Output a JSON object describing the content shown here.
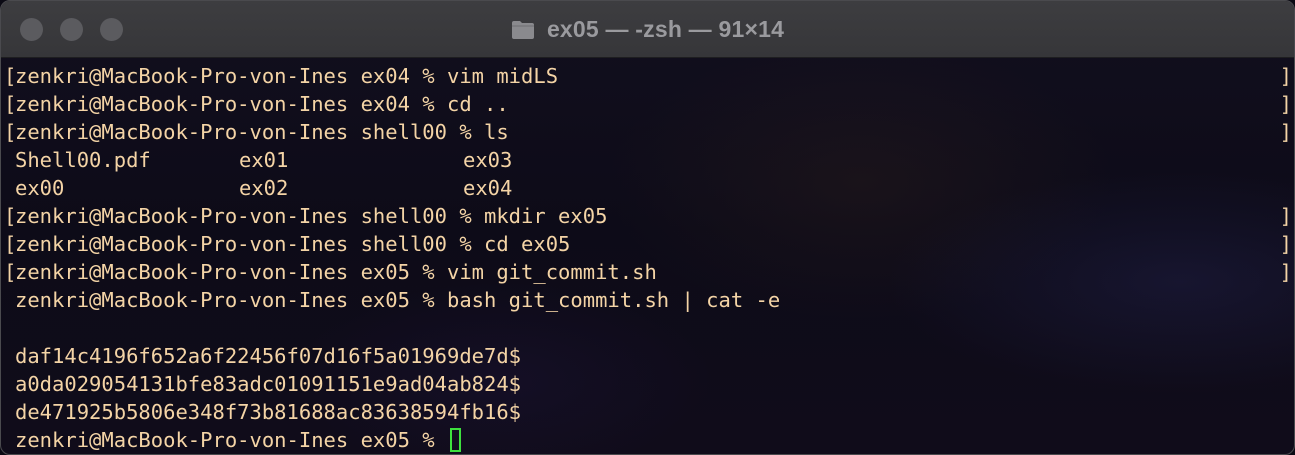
{
  "window": {
    "title": "ex05 — -zsh — 91×14"
  },
  "terminal": {
    "lines": [
      "zenkri@MacBook-Pro-von-Ines ex04 % vim midLS",
      "zenkri@MacBook-Pro-von-Ines ex04 % cd ..",
      "zenkri@MacBook-Pro-von-Ines shell00 % ls",
      "zenkri@MacBook-Pro-von-Ines shell00 % mkdir ex05",
      "zenkri@MacBook-Pro-von-Ines shell00 % cd ex05",
      "zenkri@MacBook-Pro-von-Ines ex05 % vim git_commit.sh",
      "zenkri@MacBook-Pro-von-Ines ex05 % bash git_commit.sh | cat -e",
      "daf14c4196f652a6f22456f07d16f5a01969de7d$",
      "a0da029054131bfe83adc01091151e9ad04ab824$",
      "de471925b5806e348f73b81688ac83638594fb16$",
      "zenkri@MacBook-Pro-von-Ines ex05 % "
    ],
    "ls_output": [
      [
        "Shell00.pdf",
        "ex01",
        "ex03"
      ],
      [
        "ex00",
        "ex02",
        "ex04"
      ]
    ]
  },
  "colors": {
    "text": "#f4d4a6",
    "cursor": "#3ee03e",
    "titlebar": "#3a3a3d"
  }
}
